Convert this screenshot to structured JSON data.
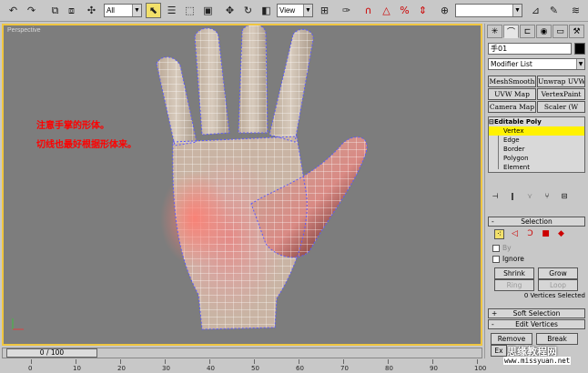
{
  "toolbar": {
    "selection_filter": "All",
    "reference_coord": "View",
    "named_selection": ""
  },
  "viewport": {
    "label": "Perspective",
    "annotation_line1": "注意手掌的形体。",
    "annotation_line2": "切线也最好根据形体来。"
  },
  "panel": {
    "object_name": "手01",
    "object_color": "#000000",
    "modifier_list": "Modifier List",
    "buttons": [
      "MeshSmooth",
      "Unwrap UVW",
      "UVW Map",
      "VertexPaint",
      "Camera Map",
      "Scaler (W"
    ],
    "stack": {
      "root": "Editable Poly",
      "items": [
        "Vertex",
        "Edge",
        "Border",
        "Polygon",
        "Element"
      ],
      "selected": "Vertex"
    },
    "selection_rollout": "Selection",
    "by_label": "By",
    "ignore_label": "Ignore",
    "shrink": "Shrink",
    "grow": "Grow",
    "ring": "Ring",
    "loop": "Loop",
    "selection_count": "0 Vertices Selected",
    "soft_selection": "Soft Selection",
    "edit_vertices": "Edit Vertices",
    "remove": "Remove",
    "break": "Break",
    "extrude_partial": "Ex"
  },
  "timeline": {
    "frame_readout": "0 / 100",
    "ticks": [
      "0",
      "10",
      "20",
      "30",
      "40",
      "50",
      "60",
      "70",
      "80",
      "90",
      "100"
    ]
  },
  "watermark": {
    "big": "思缘教程网",
    "small": "www.missyuan.net"
  },
  "colors": {
    "viewport_bg": "#7d7d7d",
    "viewport_border": "#f0c640",
    "annotation": "#ff0000",
    "stack_selected": "#fff200",
    "wire": "#5a5aff"
  }
}
